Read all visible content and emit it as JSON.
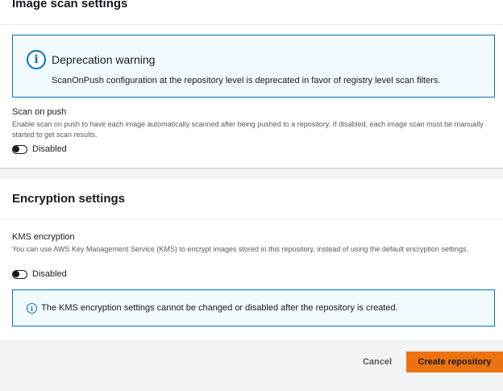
{
  "scan_section": {
    "title": "Image scan settings",
    "alert": {
      "title": "Deprecation warning",
      "text": "ScanOnPush configuration at the repository level is deprecated in favor of registry level scan filters."
    },
    "scan_on_push": {
      "label": "Scan on push",
      "description": "Enable scan on push to have each image automatically scanned after being pushed to a repository. If disabled, each image scan must be manually started to get scan results.",
      "toggle_state": "Disabled"
    }
  },
  "encryption_section": {
    "title": "Encryption settings",
    "kms": {
      "label": "KMS encryption",
      "description": "You can use AWS Key Management Service (KMS) to encrypt images stored in this repository, instead of using the default encryption settings.",
      "toggle_state": "Disabled"
    },
    "alert": {
      "text": "The KMS encryption settings cannot be changed or disabled after the repository is created."
    }
  },
  "footer": {
    "cancel_label": "Cancel",
    "create_label": "Create repository"
  },
  "colors": {
    "primary_button": "#ec7211",
    "info_blue": "#0073bb",
    "alert_bg": "#f1faff"
  }
}
